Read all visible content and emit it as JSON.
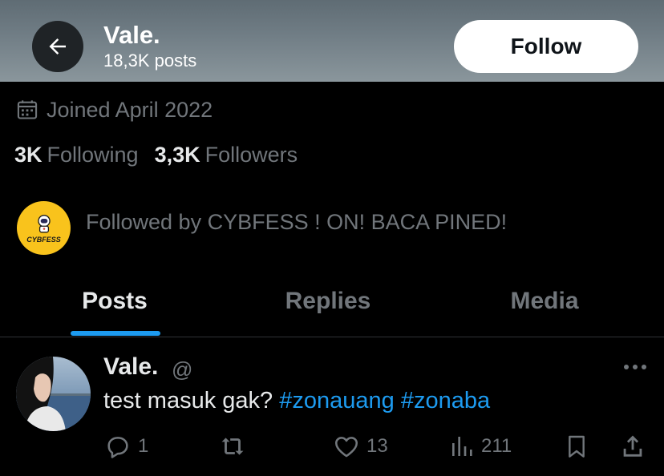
{
  "header": {
    "display_name": "Vale.",
    "posts_count": "18,3K posts",
    "follow_label": "Follow",
    "back_icon": "arrow-left-icon"
  },
  "profile": {
    "joined": "Joined April 2022",
    "following_count": "3K",
    "following_label": "Following",
    "followers_count": "3,3K",
    "followers_label": "Followers",
    "followed_by": "Followed by CYBFESS ! ON! BACA PINED!",
    "followed_by_avatar_text": "CYBFESS",
    "followed_by_avatar_color": "#f9c31c"
  },
  "tabs": [
    {
      "label": "Posts",
      "active": true
    },
    {
      "label": "Replies",
      "active": false
    },
    {
      "label": "Media",
      "active": false
    }
  ],
  "tweet": {
    "author_name": "Vale.",
    "author_handle": "@",
    "text": "test masuk gak? ",
    "hashtags": [
      "#zonauang",
      "#zonaba"
    ],
    "reply_count": "1",
    "retweet_count": "",
    "like_count": "13",
    "views_count": "211"
  },
  "colors": {
    "background": "#000000",
    "accent": "#1d9bf0",
    "secondary_text": "#71767b",
    "primary_text": "#e7e9ea"
  }
}
